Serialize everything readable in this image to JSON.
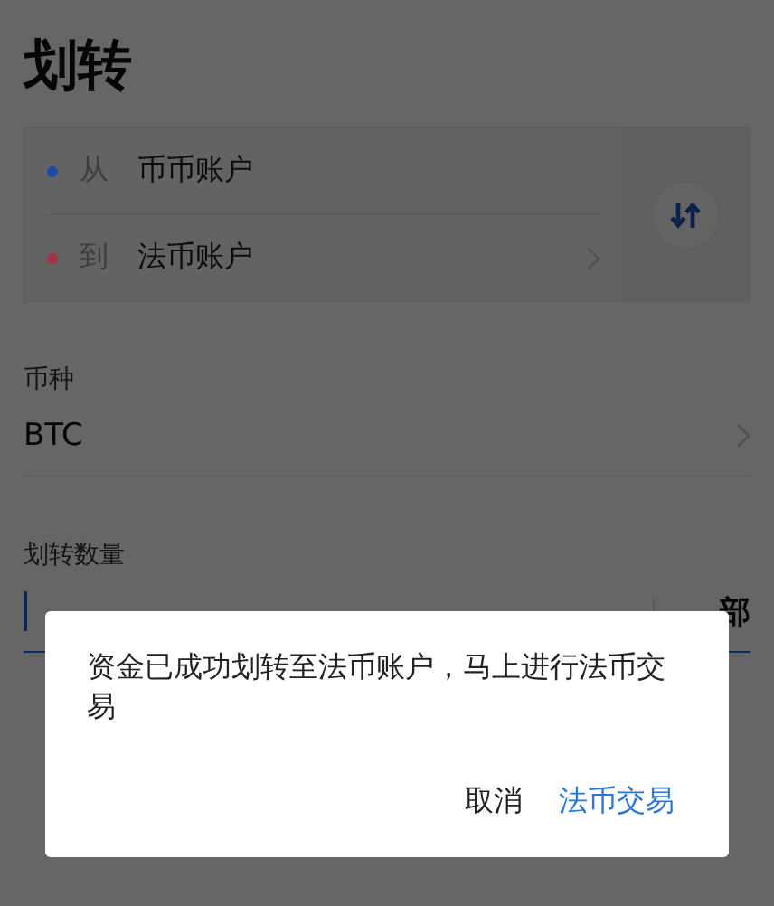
{
  "title": "划转",
  "transfer": {
    "from": {
      "label": "从",
      "account": "币币账户",
      "color": "#1d4aa8"
    },
    "to": {
      "label": "到",
      "account": "法币账户",
      "color": "#a83045"
    }
  },
  "coin": {
    "label": "币种",
    "value": "BTC"
  },
  "amount": {
    "label": "划转数量",
    "all_button": "部"
  },
  "dialog": {
    "message": "资金已成功划转至法币账户，马上进行法币交易",
    "buttons": [
      {
        "label": "取消",
        "kind": "secondary"
      },
      {
        "label": "法币交易",
        "kind": "primary"
      }
    ]
  }
}
